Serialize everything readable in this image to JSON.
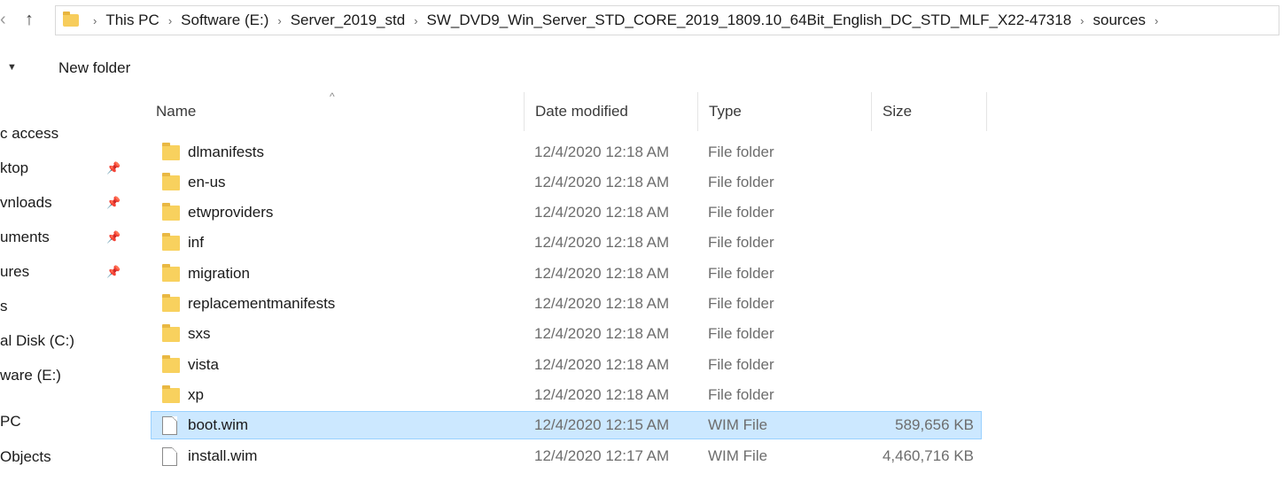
{
  "address": {
    "crumbs": [
      "This PC",
      "Software (E:)",
      "Server_2019_std",
      "SW_DVD9_Win_Server_STD_CORE_2019_1809.10_64Bit_English_DC_STD_MLF_X22-47318",
      "sources"
    ]
  },
  "toolbar": {
    "new_folder_label": "New folder"
  },
  "nav": {
    "items": [
      {
        "label": "c access"
      },
      {
        "label": "ktop"
      },
      {
        "label": "vnloads"
      },
      {
        "label": "uments"
      },
      {
        "label": "ures"
      },
      {
        "label": "s"
      },
      {
        "label": "al Disk (C:)"
      },
      {
        "label": "ware (E:)"
      },
      {
        "label": "PC"
      },
      {
        "label": "Objects"
      }
    ]
  },
  "columns": {
    "name": "Name",
    "date": "Date modified",
    "type": "Type",
    "size": "Size"
  },
  "files": [
    {
      "name": "dlmanifests",
      "date": "12/4/2020 12:18 AM",
      "type": "File folder",
      "size": ""
    },
    {
      "name": "en-us",
      "date": "12/4/2020 12:18 AM",
      "type": "File folder",
      "size": ""
    },
    {
      "name": "etwproviders",
      "date": "12/4/2020 12:18 AM",
      "type": "File folder",
      "size": ""
    },
    {
      "name": "inf",
      "date": "12/4/2020 12:18 AM",
      "type": "File folder",
      "size": ""
    },
    {
      "name": "migration",
      "date": "12/4/2020 12:18 AM",
      "type": "File folder",
      "size": ""
    },
    {
      "name": "replacementmanifests",
      "date": "12/4/2020 12:18 AM",
      "type": "File folder",
      "size": ""
    },
    {
      "name": "sxs",
      "date": "12/4/2020 12:18 AM",
      "type": "File folder",
      "size": ""
    },
    {
      "name": "vista",
      "date": "12/4/2020 12:18 AM",
      "type": "File folder",
      "size": ""
    },
    {
      "name": "xp",
      "date": "12/4/2020 12:18 AM",
      "type": "File folder",
      "size": ""
    },
    {
      "name": "boot.wim",
      "date": "12/4/2020 12:15 AM",
      "type": "WIM File",
      "size": "589,656 KB"
    },
    {
      "name": "install.wim",
      "date": "12/4/2020 12:17 AM",
      "type": "WIM File",
      "size": "4,460,716 KB"
    }
  ]
}
